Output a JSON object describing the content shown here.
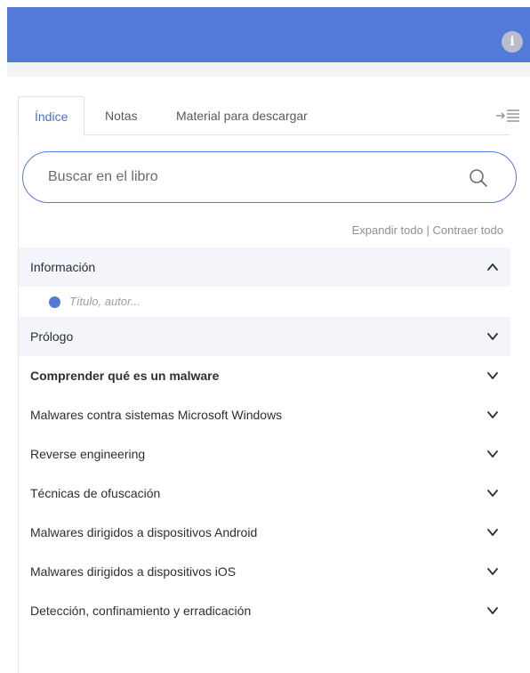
{
  "header": {
    "info_glyph": "i",
    "accent_color": "#5479d9"
  },
  "tabs": [
    {
      "label": "Índice",
      "active": true
    },
    {
      "label": "Notas",
      "active": false
    },
    {
      "label": "Material para descargar",
      "active": false
    }
  ],
  "search": {
    "placeholder": "Buscar en el libro",
    "value": ""
  },
  "actions": {
    "expand_all": "Expandir todo",
    "separator": "|",
    "collapse_all": "Contraer todo"
  },
  "toc": {
    "items": [
      {
        "label": "Información",
        "expanded": true
      },
      {
        "label": "Prólogo",
        "expanded": false
      },
      {
        "label": "Comprender qué es un malware",
        "expanded": false
      },
      {
        "label": "Malwares contra sistemas Microsoft Windows",
        "expanded": false
      },
      {
        "label": "Reverse engineering",
        "expanded": false
      },
      {
        "label": "Técnicas de ofuscación",
        "expanded": false
      },
      {
        "label": "Malwares dirigidos a dispositivos Android",
        "expanded": false
      },
      {
        "label": "Malwares dirigidos a dispositivos iOS",
        "expanded": false
      },
      {
        "label": "Detección, confinamiento y erradicación",
        "expanded": false
      }
    ],
    "sub_items": [
      {
        "label": "Título, autor...",
        "dot_color": "#5479d9"
      }
    ]
  }
}
